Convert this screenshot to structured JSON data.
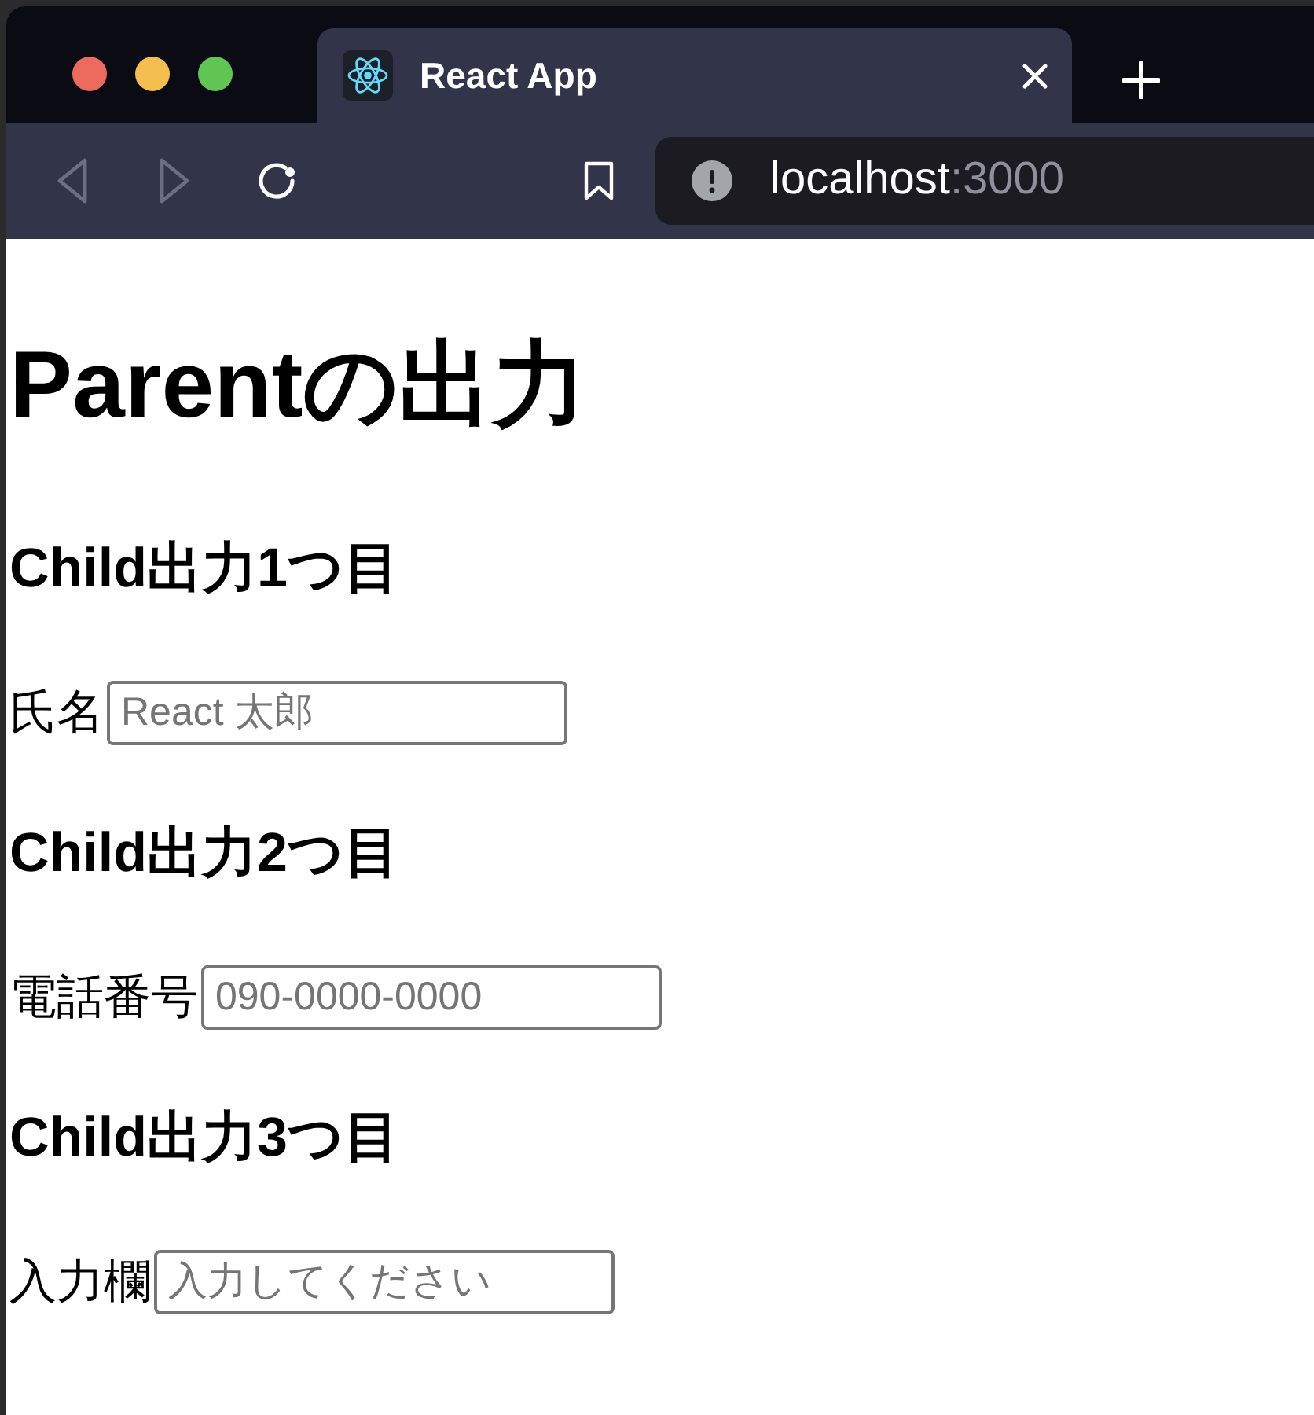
{
  "browser": {
    "tabs": [
      {
        "title": "React App",
        "selected": true
      }
    ],
    "nav_buttons": [
      {
        "kind": "back",
        "disabled": true
      },
      {
        "kind": "forward",
        "disabled": true
      },
      {
        "kind": "reload",
        "disabled": false
      }
    ],
    "address": {
      "host": "localhost",
      "port": ":3000"
    }
  },
  "page": {
    "heading": "Parentの出力",
    "sections": [
      {
        "heading": "Child出力1つ目",
        "label": "氏名",
        "placeholder": "React 太郎"
      },
      {
        "heading": "Child出力2つ目",
        "label": "電話番号",
        "placeholder": "090-0000-0000"
      },
      {
        "heading": "Child出力3つ目",
        "label": "入力欄",
        "placeholder": "入力してください"
      }
    ]
  }
}
